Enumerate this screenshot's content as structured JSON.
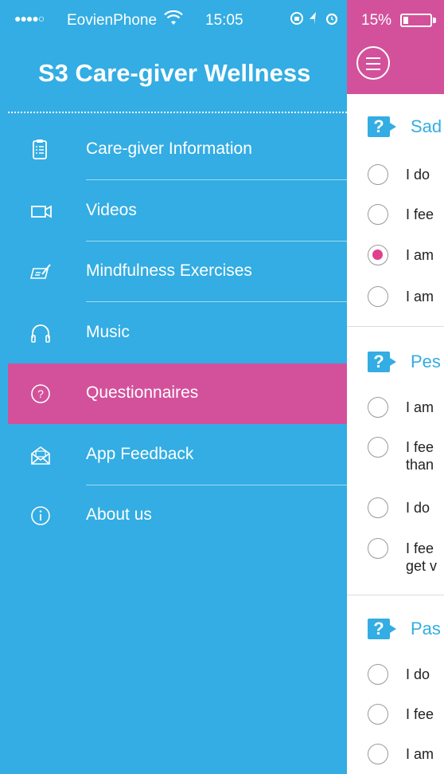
{
  "status_bar": {
    "signal": "●●●●○",
    "carrier": "EovienPhone",
    "time": "15:05",
    "battery": "15%"
  },
  "drawer": {
    "title": "S3 Care-giver Wellness",
    "items": [
      {
        "label": "Care-giver Information",
        "icon": "clipboard-list-icon"
      },
      {
        "label": "Videos",
        "icon": "video-camera-icon"
      },
      {
        "label": "Mindfulness Exercises",
        "icon": "notepad-pen-icon"
      },
      {
        "label": "Music",
        "icon": "headphones-icon"
      },
      {
        "label": "Questionnaires",
        "icon": "question-circle-icon",
        "active": true
      },
      {
        "label": "App Feedback",
        "icon": "envelope-open-icon"
      },
      {
        "label": "About us",
        "icon": "info-circle-icon"
      }
    ]
  },
  "questionnaire": {
    "sections": [
      {
        "title": "Sad",
        "options": [
          {
            "text": "I do",
            "selected": false
          },
          {
            "text": "I fee",
            "selected": false
          },
          {
            "text": "I am",
            "selected": true
          },
          {
            "text": "I am",
            "selected": false
          }
        ]
      },
      {
        "title": "Pes",
        "options": [
          {
            "text": "I am",
            "selected": false
          },
          {
            "text": "I fee",
            "line2": "than",
            "selected": false
          },
          {
            "text": "I do",
            "selected": false
          },
          {
            "text": "I fee",
            "line2": "get v",
            "selected": false
          }
        ]
      },
      {
        "title": "Pas",
        "options": [
          {
            "text": "I do",
            "selected": false
          },
          {
            "text": "I fee",
            "selected": false
          },
          {
            "text": "I am",
            "selected": false
          }
        ]
      }
    ]
  },
  "colors": {
    "drawer_blue": "#33ade3",
    "accent_pink": "#d3519b",
    "radio_selected": "#e0408e"
  }
}
